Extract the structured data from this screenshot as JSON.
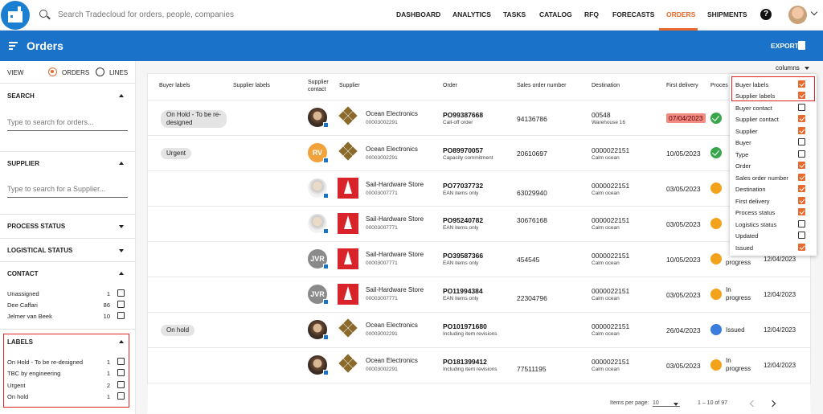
{
  "header": {
    "search_placeholder": "Search Tradecloud for orders, people, companies",
    "nav": [
      "DASHBOARD",
      "ANALYTICS",
      "TASKS",
      "CATALOG",
      "RFQ",
      "FORECASTS",
      "ORDERS",
      "SHIPMENTS"
    ],
    "active_nav": "ORDERS",
    "help": "?"
  },
  "page": {
    "title": "Orders",
    "export_label": "EXPORT"
  },
  "sidebar": {
    "view_label": "VIEW",
    "view_orders": "ORDERS",
    "view_lines": "LINES",
    "search_heading": "SEARCH",
    "search_placeholder": "Type to search for orders...",
    "supplier_heading": "SUPPLIER",
    "supplier_placeholder": "Type to search for a Supplier...",
    "process_status": "PROCESS STATUS",
    "logistical_status": "LOGISTICAL STATUS",
    "contact_heading": "CONTACT",
    "contacts": [
      {
        "name": "Unassigned",
        "count": "1"
      },
      {
        "name": "Dee Caffari",
        "count": "86"
      },
      {
        "name": "Jelmer van Beek",
        "count": "10"
      }
    ],
    "labels_heading": "LABELS",
    "labels": [
      {
        "name": "On Hold - To be re-designed",
        "count": "1"
      },
      {
        "name": "TBC by engineering",
        "count": "1"
      },
      {
        "name": "Urgent",
        "count": "2"
      },
      {
        "name": "On hold",
        "count": "1"
      }
    ]
  },
  "table": {
    "columns_label": "columns",
    "headers": {
      "buyer_labels": "Buyer labels",
      "supplier_labels": "Supplier labels",
      "supplier_contact_1": "Supplier",
      "supplier_contact_2": "contact",
      "supplier": "Supplier",
      "order": "Order",
      "sales_order_number": "Sales order number",
      "destination": "Destination",
      "first_delivery": "First delivery",
      "process": "Proces"
    },
    "rows": [
      {
        "label_1": "On Hold - To be re-",
        "label_2": "designed",
        "avatar": "photo",
        "supplier": "Ocean Electronics",
        "code": "00003002291",
        "order": "PO99387668",
        "order_sub": "Call-off order",
        "son": "94136786",
        "dest": "00548",
        "dest_sub": "Warehouse 16",
        "first_delivery": "07/04/2023",
        "status": "green",
        "issued": ""
      },
      {
        "label_1": "Urgent",
        "label_2": "",
        "avatar": "RV",
        "supplier": "Ocean Electronics",
        "code": "00003002291",
        "order": "PO89970057",
        "order_sub": "Capacity commitment",
        "son": "20610697",
        "dest": "0000022151",
        "dest_sub": "Calm ocean",
        "first_delivery": "10/05/2023",
        "status": "green",
        "issued": ""
      },
      {
        "label_1": "",
        "label_2": "",
        "avatar": "photo2",
        "supplier": "Sail-Hardware Store",
        "code": "00003007771",
        "order": "PO77037732",
        "order_sub": "EAN items only",
        "son": "63029940",
        "dest": "0000022151",
        "dest_sub": "Calm ocean",
        "first_delivery": "03/05/2023",
        "status": "orange",
        "issued": ""
      },
      {
        "label_1": "",
        "label_2": "",
        "avatar": "photo2",
        "supplier": "Sail-Hardware Store",
        "code": "00003007771",
        "order": "PO95240782",
        "order_sub": "EAN items only",
        "son": "30676168",
        "dest": "0000022151",
        "dest_sub": "Calm ocean",
        "first_delivery": "03/05/2023",
        "status": "orange",
        "issued": ""
      },
      {
        "label_1": "",
        "label_2": "",
        "avatar": "JVR",
        "supplier": "Sail-Hardware Store",
        "code": "00003007771",
        "order": "PO39587366",
        "order_sub": "EAN items only",
        "son": "454545",
        "dest": "0000022151",
        "dest_sub": "Calm ocean",
        "first_delivery": "10/05/2023",
        "status": "orange",
        "status_text": "progress",
        "issued": "12/04/2023"
      },
      {
        "label_1": "",
        "label_2": "",
        "avatar": "JVR",
        "supplier": "Sail-Hardware Store",
        "code": "00003007771",
        "order": "PO11994384",
        "order_sub": "EAN items only",
        "son": "22304796",
        "dest": "0000022151",
        "dest_sub": "Calm ocean",
        "first_delivery": "03/05/2023",
        "status": "orange",
        "status_text_1": "In",
        "status_text_2": "progress",
        "issued": "12/04/2023"
      },
      {
        "label_1": "On hold",
        "label_2": "",
        "avatar": "photo",
        "supplier": "Ocean Electronics",
        "code": "00003002291",
        "order": "PO101971680",
        "order_sub": "Including item revisions",
        "son": "",
        "dest": "0000022151",
        "dest_sub": "Calm ocean",
        "first_delivery": "26/04/2023",
        "status": "blue",
        "status_text_1": "Issued",
        "issued": "12/04/2023"
      },
      {
        "label_1": "",
        "label_2": "",
        "avatar": "photo",
        "supplier": "Ocean Electronics",
        "code": "00003002291",
        "order": "PO181399412",
        "order_sub": "Including item revisions",
        "son": "77511195",
        "dest": "0000022151",
        "dest_sub": "Calm ocean",
        "first_delivery": "03/05/2023",
        "status": "orange",
        "status_text_1": "In",
        "status_text_2": "progress",
        "issued": "12/04/2023"
      }
    ],
    "pager": {
      "items_per_page": "Items per page:",
      "per_page_value": "10",
      "range": "1 – 10 of 97"
    }
  },
  "column_panel": {
    "items": [
      {
        "name": "Buyer labels",
        "checked": true
      },
      {
        "name": "Supplier labels",
        "checked": true
      },
      {
        "name": "Buyer contact",
        "checked": false
      },
      {
        "name": "Supplier contact",
        "checked": true
      },
      {
        "name": "Supplier",
        "checked": true
      },
      {
        "name": "Buyer",
        "checked": false
      },
      {
        "name": "Type",
        "checked": false
      },
      {
        "name": "Order",
        "checked": true
      },
      {
        "name": "Sales order number",
        "checked": true
      },
      {
        "name": "Destination",
        "checked": true
      },
      {
        "name": "First delivery",
        "checked": true
      },
      {
        "name": "Process status",
        "checked": true
      },
      {
        "name": "Logistics status",
        "checked": false
      },
      {
        "name": "Updated",
        "checked": false
      },
      {
        "name": "Issued",
        "checked": true
      }
    ]
  },
  "colors": {
    "brand_blue": "#1a73c9",
    "accent_orange": "#e8692e",
    "highlight_red": "#e02424"
  }
}
